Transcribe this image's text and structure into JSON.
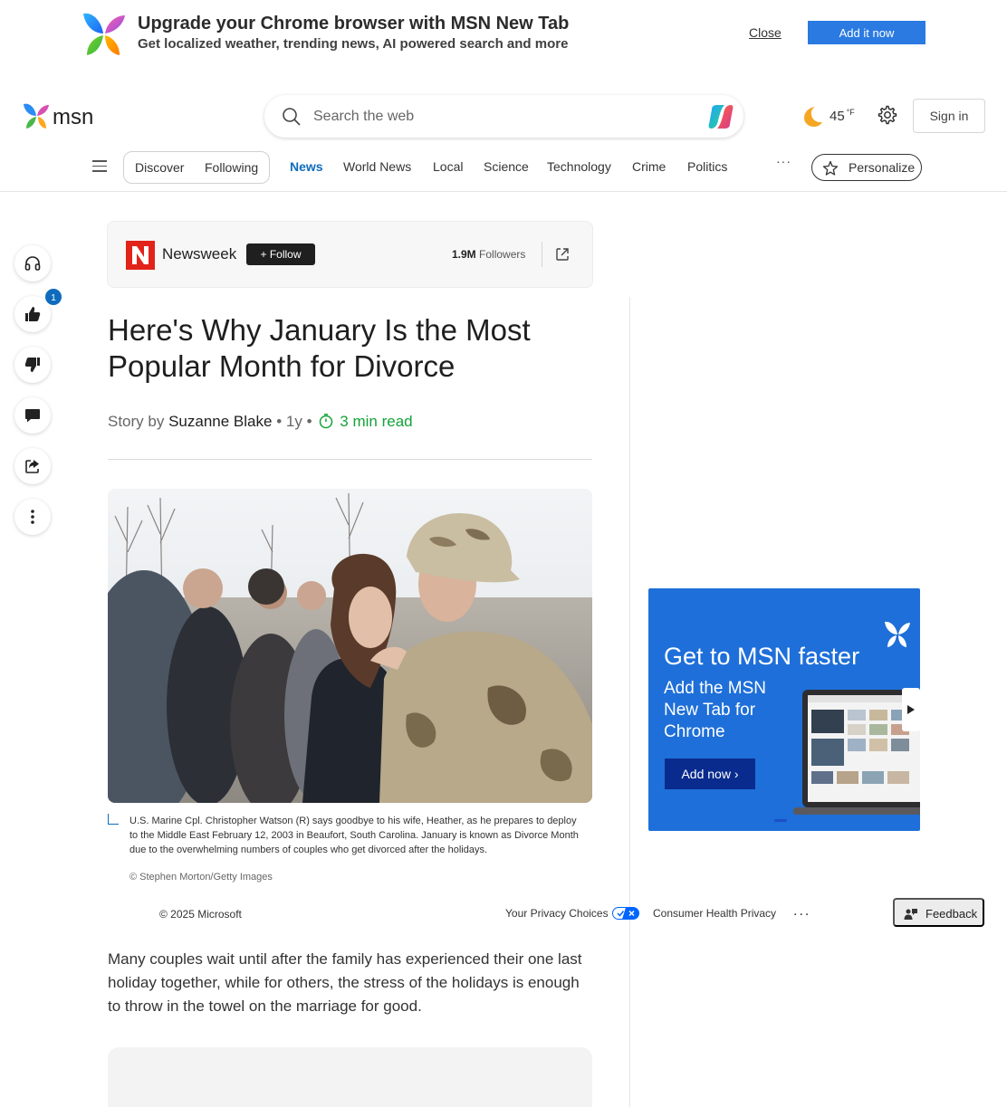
{
  "banner": {
    "title": "Upgrade your Chrome browser with MSN New Tab",
    "subtitle": "Get localized weather, trending news, AI powered search and more",
    "close_label": "Close",
    "add_label": "Add it now"
  },
  "header": {
    "logo_text": "msn",
    "search_placeholder": "Search the web",
    "temperature": "45",
    "temperature_unit": "°F",
    "signin_label": "Sign in"
  },
  "nav": {
    "pills": [
      "Discover",
      "Following"
    ],
    "items": [
      "News",
      "World News",
      "Local",
      "Science",
      "Technology",
      "Crime",
      "Politics"
    ],
    "active": "News",
    "more_label": "···",
    "personalize_label": "Personalize"
  },
  "rail": {
    "like_count": "1"
  },
  "publisher": {
    "logo_letter": "N",
    "name": "Newsweek",
    "follow_label": "Follow",
    "followers_count": "1.9M",
    "followers_label": "Followers"
  },
  "article": {
    "headline": "Here's Why January Is the Most Popular Month for Divorce",
    "byline_prefix": "Story by",
    "author": "Suzanne Blake",
    "age": "1y",
    "read_time": "3 min read",
    "caption": "U.S. Marine Cpl. Christopher Watson (R) says goodbye to his wife, Heather, as he prepares to deploy to the Middle East February 12, 2003 in Beaufort, South Carolina. January is known as Divorce Month due to the overwhelming numbers of couples who get divorced after the holidays.",
    "credit": "© Stephen Morton/Getty Images",
    "paragraph": "Many couples wait until after the family has experienced their one last holiday together, while for others, the stress of the holidays is enough to throw in the towel on the marriage for good."
  },
  "footer": {
    "copyright": "© 2025 Microsoft",
    "privacy": "Your Privacy Choices",
    "health": "Consumer Health Privacy",
    "more": "...",
    "feedback": "Feedback"
  },
  "ad": {
    "title": "Get to MSN faster",
    "subtitle": "Add the MSN New Tab for Chrome",
    "button": "Add now"
  },
  "colors": {
    "accent": "#0f6cbd",
    "read_time": "#14a338",
    "ad_background": "#1e6fd9",
    "brand_red": "#e2231a"
  }
}
